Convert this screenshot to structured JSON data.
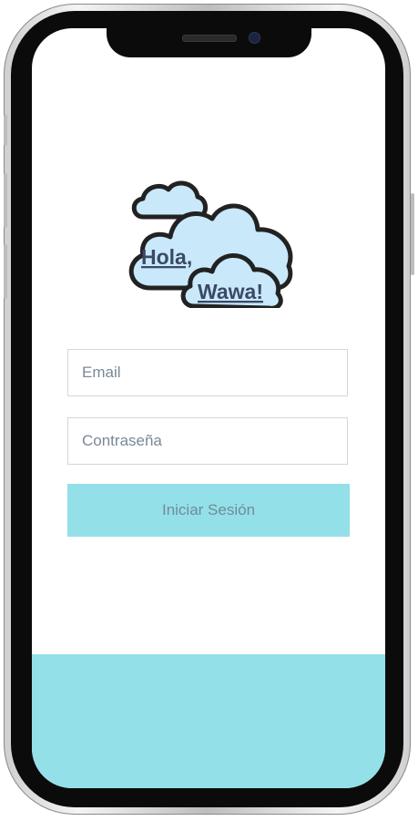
{
  "logo": {
    "line1": "Hola,",
    "line2": "Wawa!"
  },
  "login": {
    "email_placeholder": "Email",
    "password_placeholder": "Contraseña",
    "submit_label": "Iniciar Sesión"
  },
  "colors": {
    "accent": "#93e0e9",
    "cloud_fill": "#c9e9fb",
    "outline": "#222222"
  }
}
